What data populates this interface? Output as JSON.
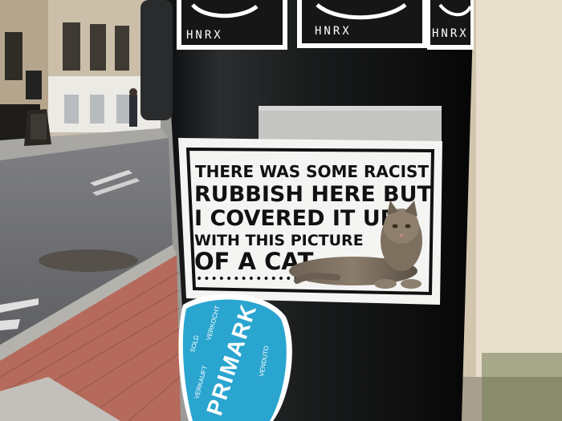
{
  "scene": {
    "stickers_top": [
      "HNRX",
      "HNRX",
      "HNRX"
    ],
    "cat_sticker": {
      "lines": [
        "THERE WAS SOME RACIST",
        "RUBBISH HERE BUT",
        "I COVERED IT UP",
        "WITH THIS PICTURE",
        "OF A CAT"
      ]
    },
    "primark_sticker": {
      "brand": "PRIMARK",
      "small": [
        "SOLD",
        "VERKOCHT",
        "VENDUTO",
        "VERKAUFT"
      ]
    }
  },
  "colors": {
    "pole": "#16181a",
    "primark_blue": "#2aa5cf",
    "wall": "#d9cfbd",
    "brick": "#b8685a"
  }
}
